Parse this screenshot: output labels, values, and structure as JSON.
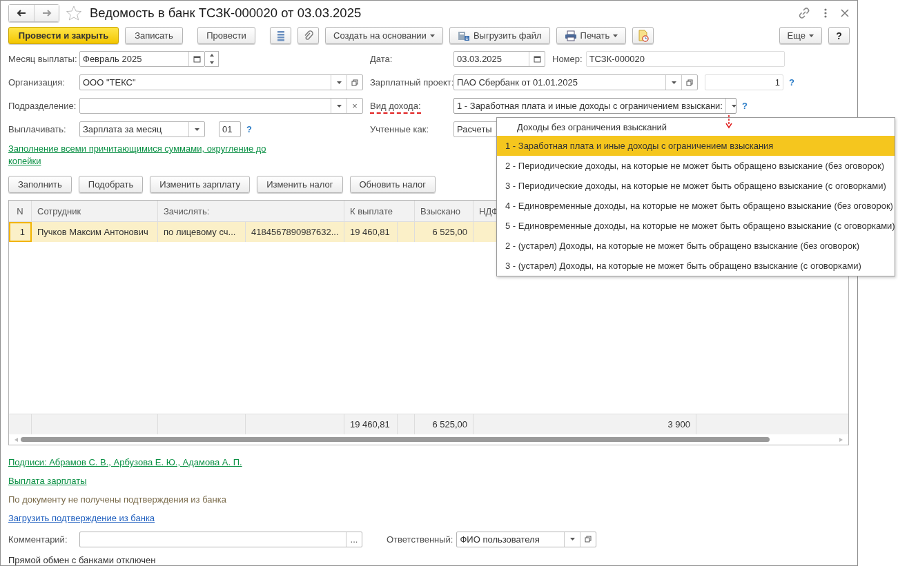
{
  "window": {
    "title": "Ведомость в банк ТСЗК-000020 от 03.03.2025",
    "favorite": false
  },
  "toolbar": {
    "post_close": "Провести и закрыть",
    "save": "Записать",
    "post": "Провести",
    "create_based": "Создать на основании",
    "export": "Выгрузить файл",
    "print": "Печать",
    "more": "Еще",
    "help": "?"
  },
  "form": {
    "month": {
      "label": "Месяц выплаты:",
      "value": "Февраль 2025"
    },
    "organization": {
      "label": "Организация:",
      "value": "ООО \"ТЕКС\""
    },
    "department": {
      "label": "Подразделение:",
      "clear": "×"
    },
    "pay": {
      "label": "Выплачивать:",
      "value": "Зарплата за месяц",
      "number": "01",
      "help": "?"
    },
    "date": {
      "label": "Дата:",
      "value": "03.03.2025"
    },
    "number": {
      "label": "Номер:",
      "value": "ТСЗК-000020"
    },
    "salary_project": {
      "label": "Зарплатный проект:",
      "value": "ПАО Сбербанк от 01.01.2025",
      "count": "1",
      "help": "?"
    },
    "income_type": {
      "label": "Вид дохода:",
      "value": "1 - Заработная плата и иные доходы с ограничением взыскани:",
      "help": "?",
      "error": true,
      "expanded": true
    },
    "accounted": {
      "label": "Учтенные как:",
      "value": "Расчеты"
    }
  },
  "fill_link": "Заполнение всеми причитающимися суммами, округление до копейки",
  "table_buttons": [
    "Заполнить",
    "Подобрать",
    "Изменить зарплату",
    "Изменить налог",
    "Обновить налог"
  ],
  "table": {
    "columns": [
      "N",
      "Сотрудник",
      "Зачислять:",
      "К выплате",
      "Взыскано",
      "НДФ"
    ],
    "rows": [
      {
        "n": "1",
        "employee": "Пучков Максим Антонович",
        "credit_to": "по лицевому сч...",
        "account": "4184567890987632...",
        "to_pay": "19 460,81",
        "collected": "6 525,00",
        "selected": true
      }
    ],
    "totals": {
      "to_pay": "19 460,81",
      "collected": "6 525,00",
      "column_7": "3 900"
    }
  },
  "dropdown": [
    {
      "label": "Доходы без ограничения взысканий",
      "selected": false,
      "kind": "none"
    },
    {
      "label": "1 - Заработная плата и иные доходы с ограничением взыскания",
      "selected": true,
      "kind": "code"
    },
    {
      "label": "2 - Периодические доходы, на которые не может быть обращено взыскание (без оговорок)",
      "selected": false,
      "kind": "code"
    },
    {
      "label": "3 - Периодические доходы, на которые не может быть обращено взыскание (с оговорками)",
      "selected": false,
      "kind": "code"
    },
    {
      "label": "4 - Единовременные доходы, на которые не может быть обращено взыскание (без оговорок)",
      "selected": false,
      "kind": "code"
    },
    {
      "label": "5 - Единовременные доходы, на которые не может быть обращено взыскание (с оговорками)",
      "selected": false,
      "kind": "code"
    },
    {
      "label": "2 - (устарел) Доходы, на которые не может быть обращено взыскание (без оговорок)",
      "selected": false,
      "kind": "code"
    },
    {
      "label": "3 - (устарел) Доходы, на которые не может быть обращено взыскание (с оговорками)",
      "selected": false,
      "kind": "code"
    }
  ],
  "signatures_link": "Подписи: Абрамов С. В., Арбузова Е. Ю., Адамова А. П.",
  "payout_link": "Выплата зарплаты",
  "bank_status": "По документу не получены подтверждения из банка",
  "load_link": "Загрузить подтверждение из банка",
  "comment": {
    "label": "Комментарий:",
    "button": "..."
  },
  "responsible": {
    "label": "Ответственный:",
    "value": "ФИО пользователя"
  },
  "footer_note": "Прямой обмен с банками отключен"
}
